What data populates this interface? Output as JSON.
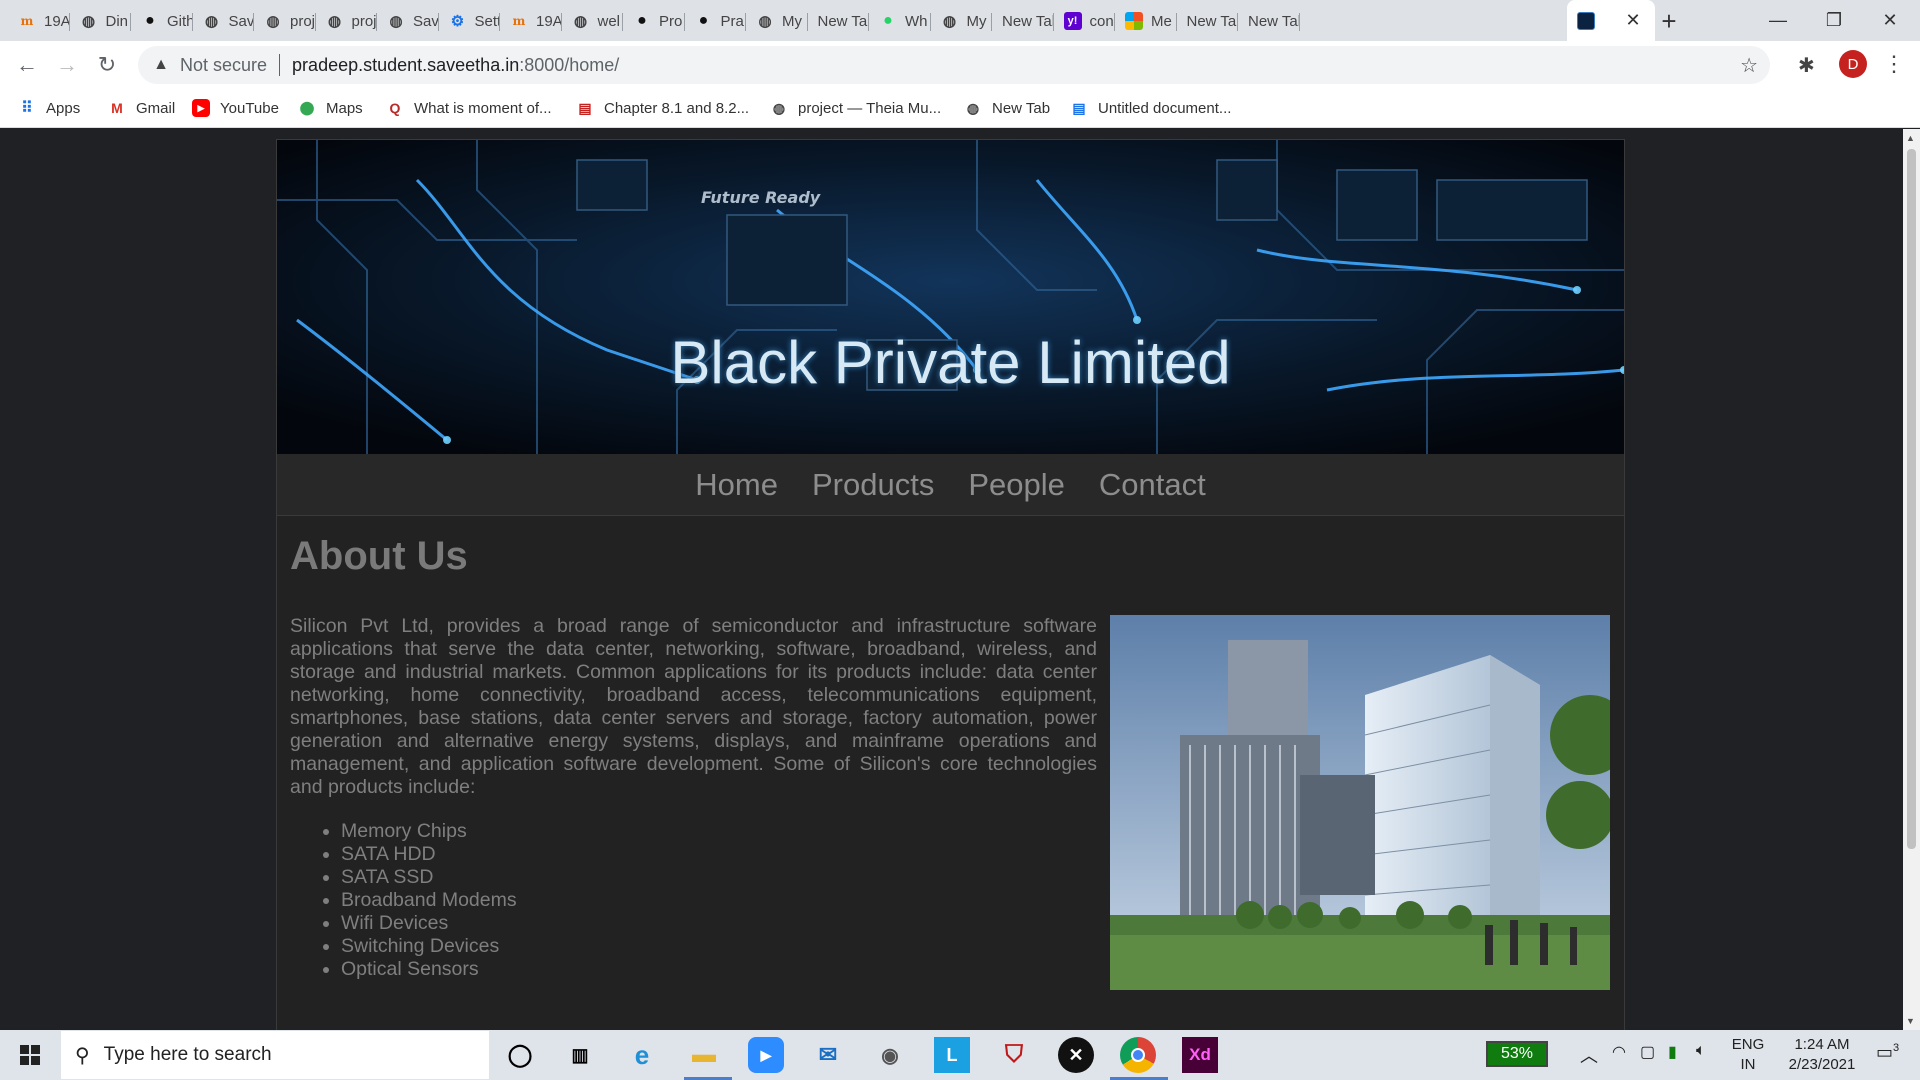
{
  "browser": {
    "tabs": [
      {
        "label": "19A",
        "icon": "m-icon"
      },
      {
        "label": "Din",
        "icon": "globe-icon"
      },
      {
        "label": "Gith",
        "icon": "github-icon"
      },
      {
        "label": "Sav",
        "icon": "globe-icon"
      },
      {
        "label": "proj",
        "icon": "globe-icon"
      },
      {
        "label": "proj",
        "icon": "globe-icon"
      },
      {
        "label": "Sav",
        "icon": "globe-icon"
      },
      {
        "label": "Sett",
        "icon": "gear-icon"
      },
      {
        "label": "19A",
        "icon": "m-icon"
      },
      {
        "label": "wel",
        "icon": "globe-icon"
      },
      {
        "label": "Pro",
        "icon": "github-icon"
      },
      {
        "label": "Pra",
        "icon": "github-icon"
      },
      {
        "label": "My",
        "icon": "globe-icon"
      },
      {
        "label": "New Tab",
        "icon": ""
      },
      {
        "label": "Wh",
        "icon": "whatsapp-icon"
      },
      {
        "label": "My",
        "icon": "globe-icon"
      },
      {
        "label": "New Tab",
        "icon": ""
      },
      {
        "label": "con",
        "icon": "yahoo-icon"
      },
      {
        "label": "Me",
        "icon": "microsoft-icon"
      },
      {
        "label": "New Tab",
        "icon": ""
      },
      {
        "label": "New Tab",
        "icon": ""
      }
    ],
    "active_tab_icon": "circuit-thumbnail-icon",
    "omnibox": {
      "security_label": "Not secure",
      "url_host": "pradeep.student.saveetha.in",
      "url_rest": ":8000/home/"
    },
    "profile_initial": "D",
    "bookmarks": [
      {
        "label": "Apps",
        "icon": "apps-grid-icon"
      },
      {
        "label": "Gmail",
        "icon": "gmail-icon"
      },
      {
        "label": "YouTube",
        "icon": "youtube-icon"
      },
      {
        "label": "Maps",
        "icon": "maps-pin-icon"
      },
      {
        "label": "What is moment of...",
        "icon": "quora-icon"
      },
      {
        "label": "Chapter 8.1 and 8.2...",
        "icon": "slides-icon"
      },
      {
        "label": "project — Theia Mu...",
        "icon": "globe-icon"
      },
      {
        "label": "New Tab",
        "icon": "globe-icon"
      },
      {
        "label": "Untitled document...",
        "icon": "docs-icon"
      }
    ]
  },
  "site": {
    "banner_tag": "Future Ready",
    "title": "Black Private Limited",
    "nav": [
      "Home",
      "Products",
      "People",
      "Contact"
    ],
    "heading": "About Us",
    "paragraph": "Silicon Pvt Ltd, provides a broad range of semiconductor and infrastructure software applications that serve the data center, networking, software, broadband, wireless, and storage and industrial markets. Common applications for its products include: data center networking, home connectivity, broadband access, telecommunications equipment, smartphones, base stations, data center servers and storage, factory automation, power generation and alternative energy systems, displays, and mainframe operations and management, and application software development. Some of Silicon's core technologies and products include:",
    "products": [
      "Memory Chips",
      "SATA HDD",
      "SATA SSD",
      "Broadband Modems",
      "Wifi Devices",
      "Switching Devices",
      "Optical Sensors"
    ]
  },
  "taskbar": {
    "search_placeholder": "Type here to search",
    "battery": "53%",
    "lang_top": "ENG",
    "lang_bottom": "IN",
    "time": "1:24 AM",
    "date": "2/23/2021",
    "notification_count": "3"
  },
  "colors": {
    "page_bg": "#202124",
    "site_bg": "#222222",
    "nav_text": "#8d8d8d",
    "body_text": "#7f7f7f",
    "title_glow": "#3a89c9"
  }
}
